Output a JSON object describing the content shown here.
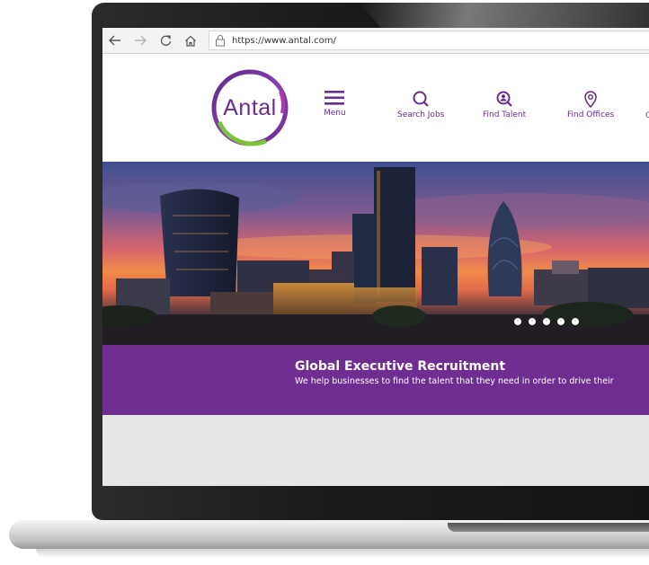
{
  "browser": {
    "url": "https://www.antal.com/",
    "back_icon": "arrow-left-icon",
    "forward_icon": "arrow-right-icon",
    "refresh_icon": "refresh-icon",
    "home_icon": "home-icon"
  },
  "site": {
    "logo_text": "Antal",
    "nav": [
      {
        "label": "Menu",
        "icon": "hamburger-icon"
      },
      {
        "label": "Search Jobs",
        "icon": "search-icon"
      },
      {
        "label": "Find Talent",
        "icon": "find-talent-icon"
      },
      {
        "label": "Find Offices",
        "icon": "location-pin-icon"
      },
      {
        "label": "C",
        "icon": "cut-off-icon"
      }
    ],
    "carousel": {
      "slide_count": 5
    },
    "banner": {
      "title": "Global Executive Recruitment",
      "subtitle": "We help businesses to find the talent that they need in order to drive their"
    }
  },
  "colors": {
    "brand_purple": "#6f2d91",
    "logo_green": "#7cc23b",
    "browser_bar": "#f3f3f3"
  }
}
